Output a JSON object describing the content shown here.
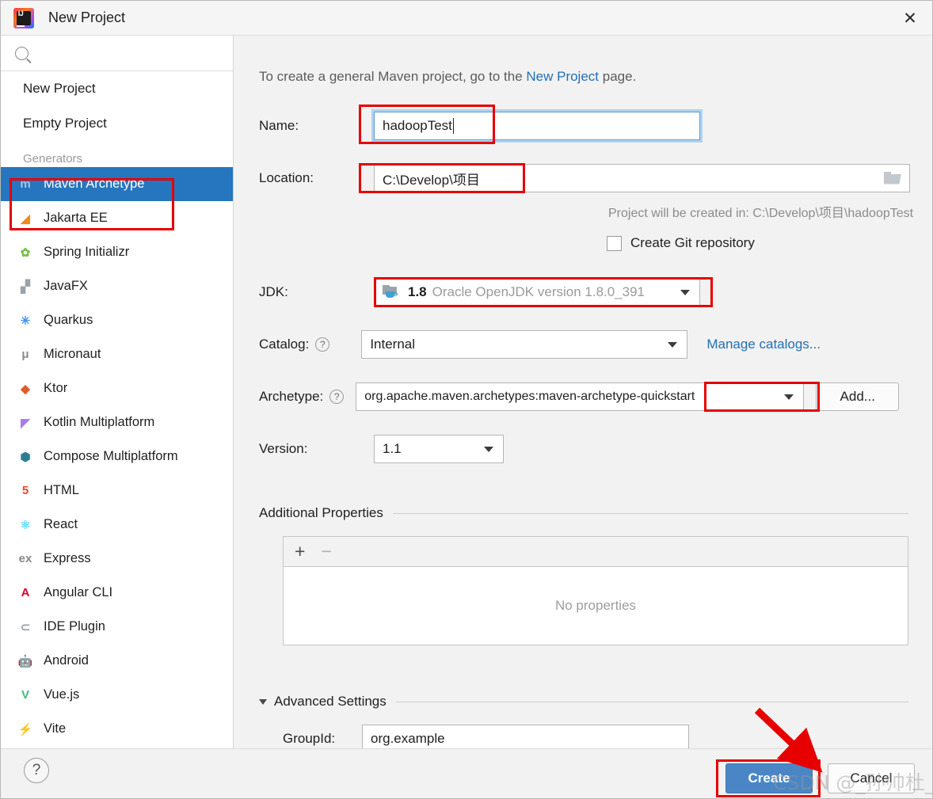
{
  "window": {
    "title": "New Project",
    "logo_icon": "intellij-idea-logo",
    "close_icon": "close-icon"
  },
  "sidebar": {
    "search": {
      "value": "",
      "placeholder": "",
      "icon": "search-icon"
    },
    "top_items": [
      {
        "label": "New Project"
      },
      {
        "label": "Empty Project"
      }
    ],
    "section_label": "Generators",
    "generators": [
      {
        "label": "Maven Archetype",
        "icon": "maven-icon",
        "glyph": "m",
        "color": "#9fc8e8",
        "selected": true
      },
      {
        "label": "Jakarta EE",
        "icon": "jakarta-ee-icon",
        "glyph": "◢",
        "color": "#f08a1c",
        "selected": false
      },
      {
        "label": "Spring Initializr",
        "icon": "spring-icon",
        "glyph": "✿",
        "color": "#79c14b",
        "selected": false
      },
      {
        "label": "JavaFX",
        "icon": "javafx-icon",
        "glyph": "▞",
        "color": "#9aa3ab",
        "selected": false
      },
      {
        "label": "Quarkus",
        "icon": "quarkus-icon",
        "glyph": "✳",
        "color": "#4695eb",
        "selected": false
      },
      {
        "label": "Micronaut",
        "icon": "micronaut-icon",
        "glyph": "μ",
        "color": "#8a8a8a",
        "selected": false
      },
      {
        "label": "Ktor",
        "icon": "ktor-icon",
        "glyph": "◆",
        "color": "#e05a2b",
        "selected": false
      },
      {
        "label": "Kotlin Multiplatform",
        "icon": "kotlin-icon",
        "glyph": "◤",
        "color": "#a97bea",
        "selected": false
      },
      {
        "label": "Compose Multiplatform",
        "icon": "compose-icon",
        "glyph": "⬢",
        "color": "#2f7d95",
        "selected": false
      },
      {
        "label": "HTML",
        "icon": "html5-icon",
        "glyph": "5",
        "color": "#e44d26",
        "selected": false
      },
      {
        "label": "React",
        "icon": "react-icon",
        "glyph": "⚛",
        "color": "#61dafb",
        "selected": false
      },
      {
        "label": "Express",
        "icon": "express-icon",
        "glyph": "ex",
        "color": "#8a8a8a",
        "selected": false
      },
      {
        "label": "Angular CLI",
        "icon": "angular-icon",
        "glyph": "A",
        "color": "#dd0031",
        "selected": false
      },
      {
        "label": "IDE Plugin",
        "icon": "ide-plugin-icon",
        "glyph": "⊂",
        "color": "#9aa3ab",
        "selected": false
      },
      {
        "label": "Android",
        "icon": "android-icon",
        "glyph": "🤖",
        "color": "#3ddc84",
        "selected": false
      },
      {
        "label": "Vue.js",
        "icon": "vuejs-icon",
        "glyph": "V",
        "color": "#41b883",
        "selected": false
      },
      {
        "label": "Vite",
        "icon": "vite-icon",
        "glyph": "⚡",
        "color": "#ffd02c",
        "selected": false
      }
    ]
  },
  "main": {
    "intro_prefix": "To create a general Maven project, go to the ",
    "intro_link": "New Project",
    "intro_suffix": " page.",
    "name": {
      "label": "Name:",
      "value": "hadoopTest"
    },
    "location": {
      "label": "Location:",
      "value": "C:\\Develop\\项目",
      "browse_icon": "folder-browse-icon"
    },
    "location_hint": "Project will be created in: C:\\Develop\\项目\\hadoopTest",
    "git": {
      "label": "Create Git repository",
      "checked": false
    },
    "jdk": {
      "label": "JDK:",
      "version": "1.8",
      "description": "Oracle OpenJDK version 1.8.0_391",
      "icon": "jdk-icon"
    },
    "catalog": {
      "label": "Catalog:",
      "value": "Internal",
      "help_icon": "help-icon",
      "manage_link": "Manage catalogs..."
    },
    "archetype": {
      "label": "Archetype:",
      "value": "org.apache.maven.archetypes:maven-archetype-quickstart",
      "help_icon": "help-icon",
      "add_button": "Add..."
    },
    "version": {
      "label": "Version:",
      "value": "1.1"
    },
    "additional_properties": {
      "title": "Additional Properties",
      "add_icon": "plus-icon",
      "remove_icon": "minus-icon",
      "empty_text": "No properties"
    },
    "advanced_settings": {
      "title": "Advanced Settings",
      "expanded": true,
      "chevron_icon": "chevron-down-icon",
      "group_id": {
        "label": "GroupId:",
        "value": "org.example"
      }
    }
  },
  "footer": {
    "help_icon": "help-icon",
    "create_button": "Create",
    "cancel_button": "Cancel"
  },
  "watermark": "CSDN @_孙帅杜_",
  "annotation_color": "#e60000"
}
